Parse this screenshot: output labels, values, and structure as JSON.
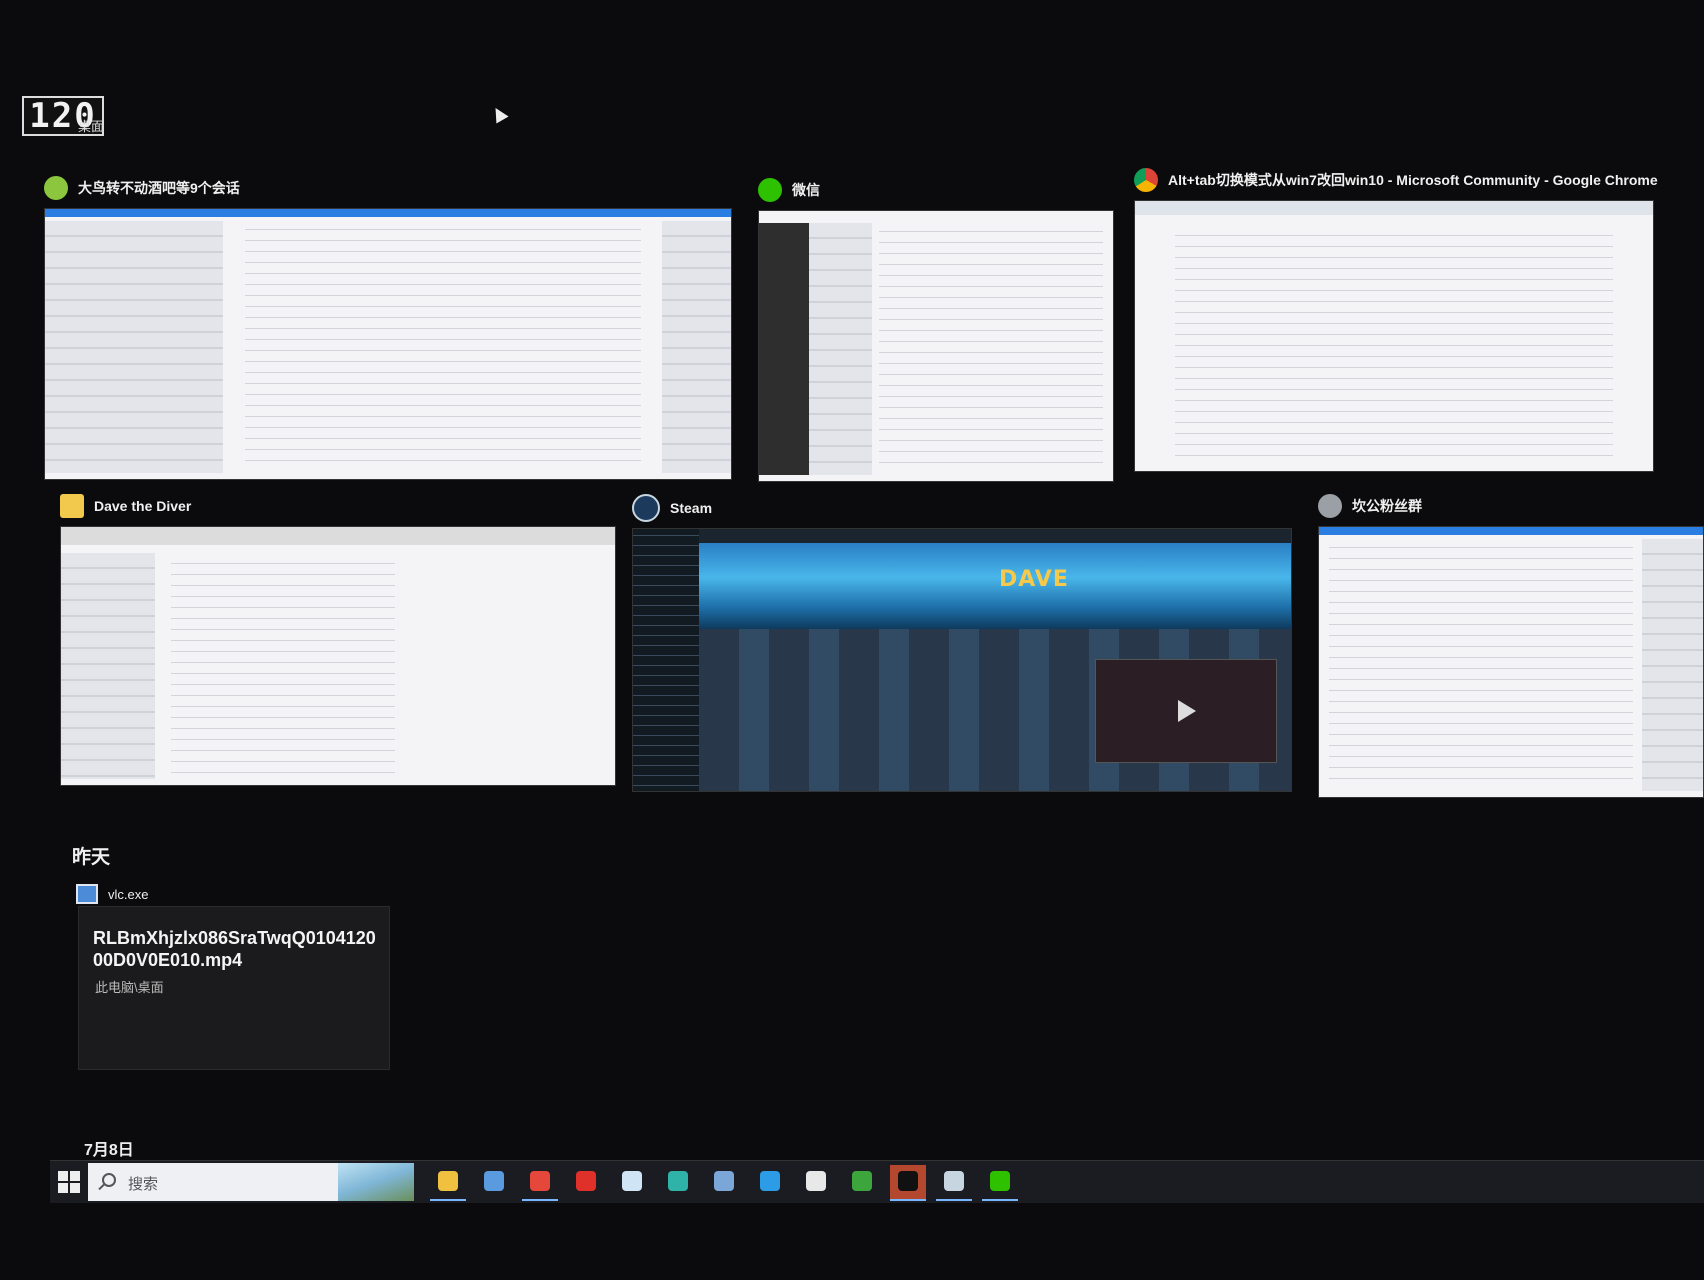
{
  "fps_overlay": {
    "value": "120",
    "subtitle": "桌面"
  },
  "windows": [
    {
      "title": "大鸟转不动酒吧等9个会话",
      "icon": "qq-chat-icon",
      "color": "#8cc63f"
    },
    {
      "title": "微信",
      "icon": "wechat-icon",
      "color": "#2dc100"
    },
    {
      "title": "Alt+tab切换模式从win7改回win10 - Microsoft Community - Google Chrome",
      "icon": "chrome-icon",
      "color": "#db4437"
    },
    {
      "title": "Dave the Diver",
      "icon": "folder-icon",
      "color": "#f2c94c"
    },
    {
      "title": "Steam",
      "icon": "steam-icon",
      "color": "#1b3a5c"
    },
    {
      "title": "坎公粉丝群",
      "icon": "qq-group-icon",
      "color": "#9aa0a6"
    }
  ],
  "steam_banner": "DAVE",
  "recent": {
    "section_label": "昨天",
    "app_name": "vlc.exe",
    "file_title": "RLBmXhjzlx086SraTwqQ010412000D0V0E010.mp4",
    "file_path": "此电脑\\桌面"
  },
  "older_section_label": "7月8日",
  "taskbar": {
    "search_placeholder": "搜索",
    "icons": [
      {
        "name": "file-explorer-icon",
        "color": "#f0c040",
        "active": true
      },
      {
        "name": "pc-manager-icon",
        "color": "#5a9be0",
        "active": false
      },
      {
        "name": "chrome-taskbar-icon",
        "color": "#e5483b",
        "active": true
      },
      {
        "name": "netease-music-icon",
        "color": "#e0302a",
        "active": false
      },
      {
        "name": "notepad-icon",
        "color": "#cfe4f5",
        "active": false
      },
      {
        "name": "edge-icon",
        "color": "#2fb3a8",
        "active": false
      },
      {
        "name": "calculator-icon",
        "color": "#7aa6d8",
        "active": false
      },
      {
        "name": "browser-icon",
        "color": "#2d9ce6",
        "active": false
      },
      {
        "name": "store-icon",
        "color": "#e8e8e8",
        "active": false
      },
      {
        "name": "xbox-icon",
        "color": "#3ca63c",
        "active": false
      },
      {
        "name": "qq-icon",
        "color": "#111111",
        "active": true,
        "highlight": true
      },
      {
        "name": "steam-taskbar-icon",
        "color": "#c7d5e0",
        "active": true
      },
      {
        "name": "wechat-taskbar-icon",
        "color": "#2dc100",
        "active": true
      }
    ]
  }
}
